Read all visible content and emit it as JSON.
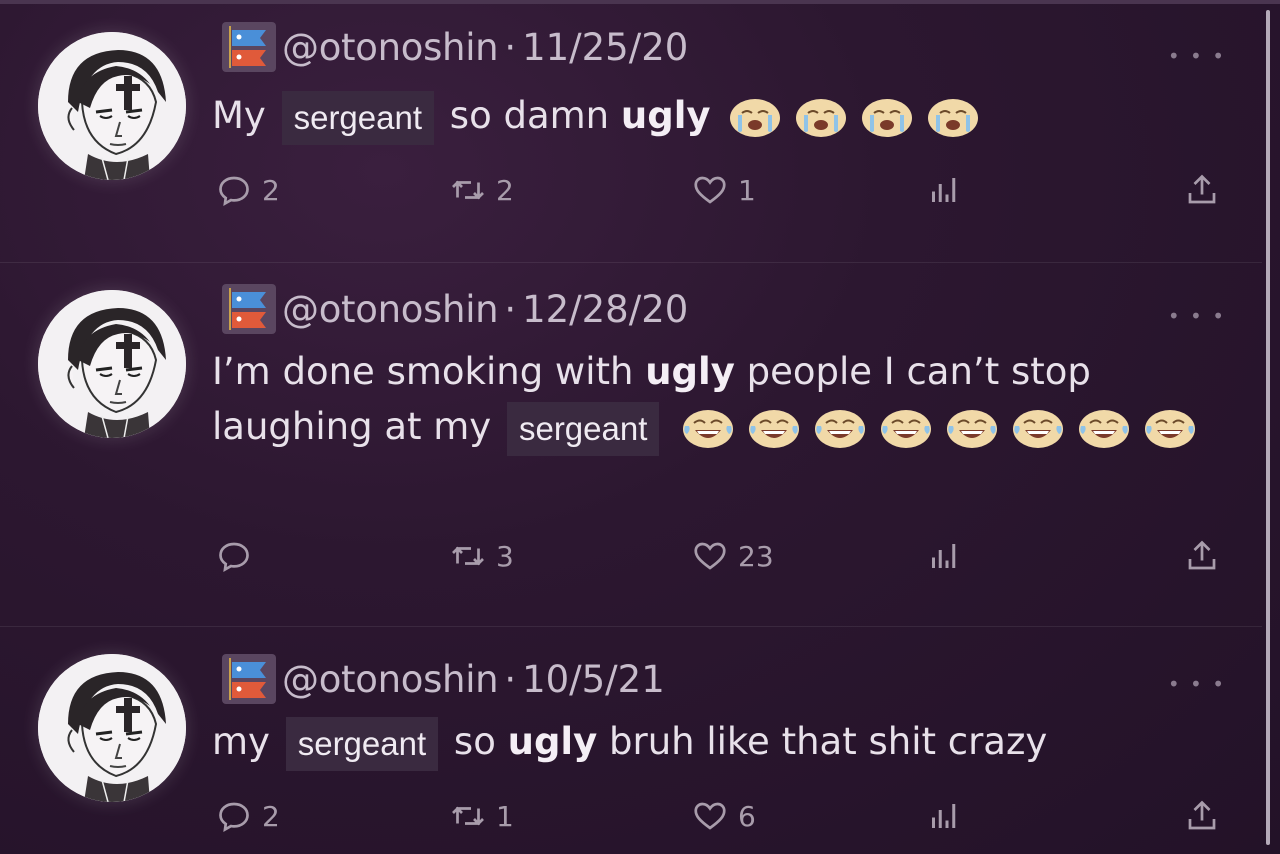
{
  "tweets": [
    {
      "handle": "@otonoshin",
      "sep": "·",
      "date": "11/25/20",
      "text": {
        "p1": "My",
        "sergeant": "sergeant",
        "p2": "so damn",
        "ugly": "ugly",
        "emoji": "😭 😭 😭 😭"
      },
      "replies": "2",
      "retweets": "2",
      "likes": "1"
    },
    {
      "handle": "@otonoshin",
      "sep": "·",
      "date": "12/28/20",
      "text": {
        "p1": "I’m done smoking with",
        "ugly": "ugly",
        "p2": "people I can’t stop laughing at my",
        "sergeant": "sergeant",
        "emoji": "😂 😂 😂 😂 😂 😂 😂 😂"
      },
      "replies": "",
      "retweets": "3",
      "likes": "23"
    },
    {
      "handle": "@otonoshin",
      "sep": "·",
      "date": "10/5/21",
      "text": {
        "p1": "my",
        "sergeant": "sergeant",
        "p2": "so",
        "ugly": "ugly",
        "p3": "bruh like that shit crazy"
      },
      "replies": "2",
      "retweets": "1",
      "likes": "6"
    }
  ],
  "more_label": "• • •",
  "icons": {
    "reply": "reply-icon",
    "retweet": "retweet-icon",
    "like": "heart-icon",
    "views": "views-icon",
    "share": "share-icon",
    "flag": "koinobori-flag-icon"
  }
}
